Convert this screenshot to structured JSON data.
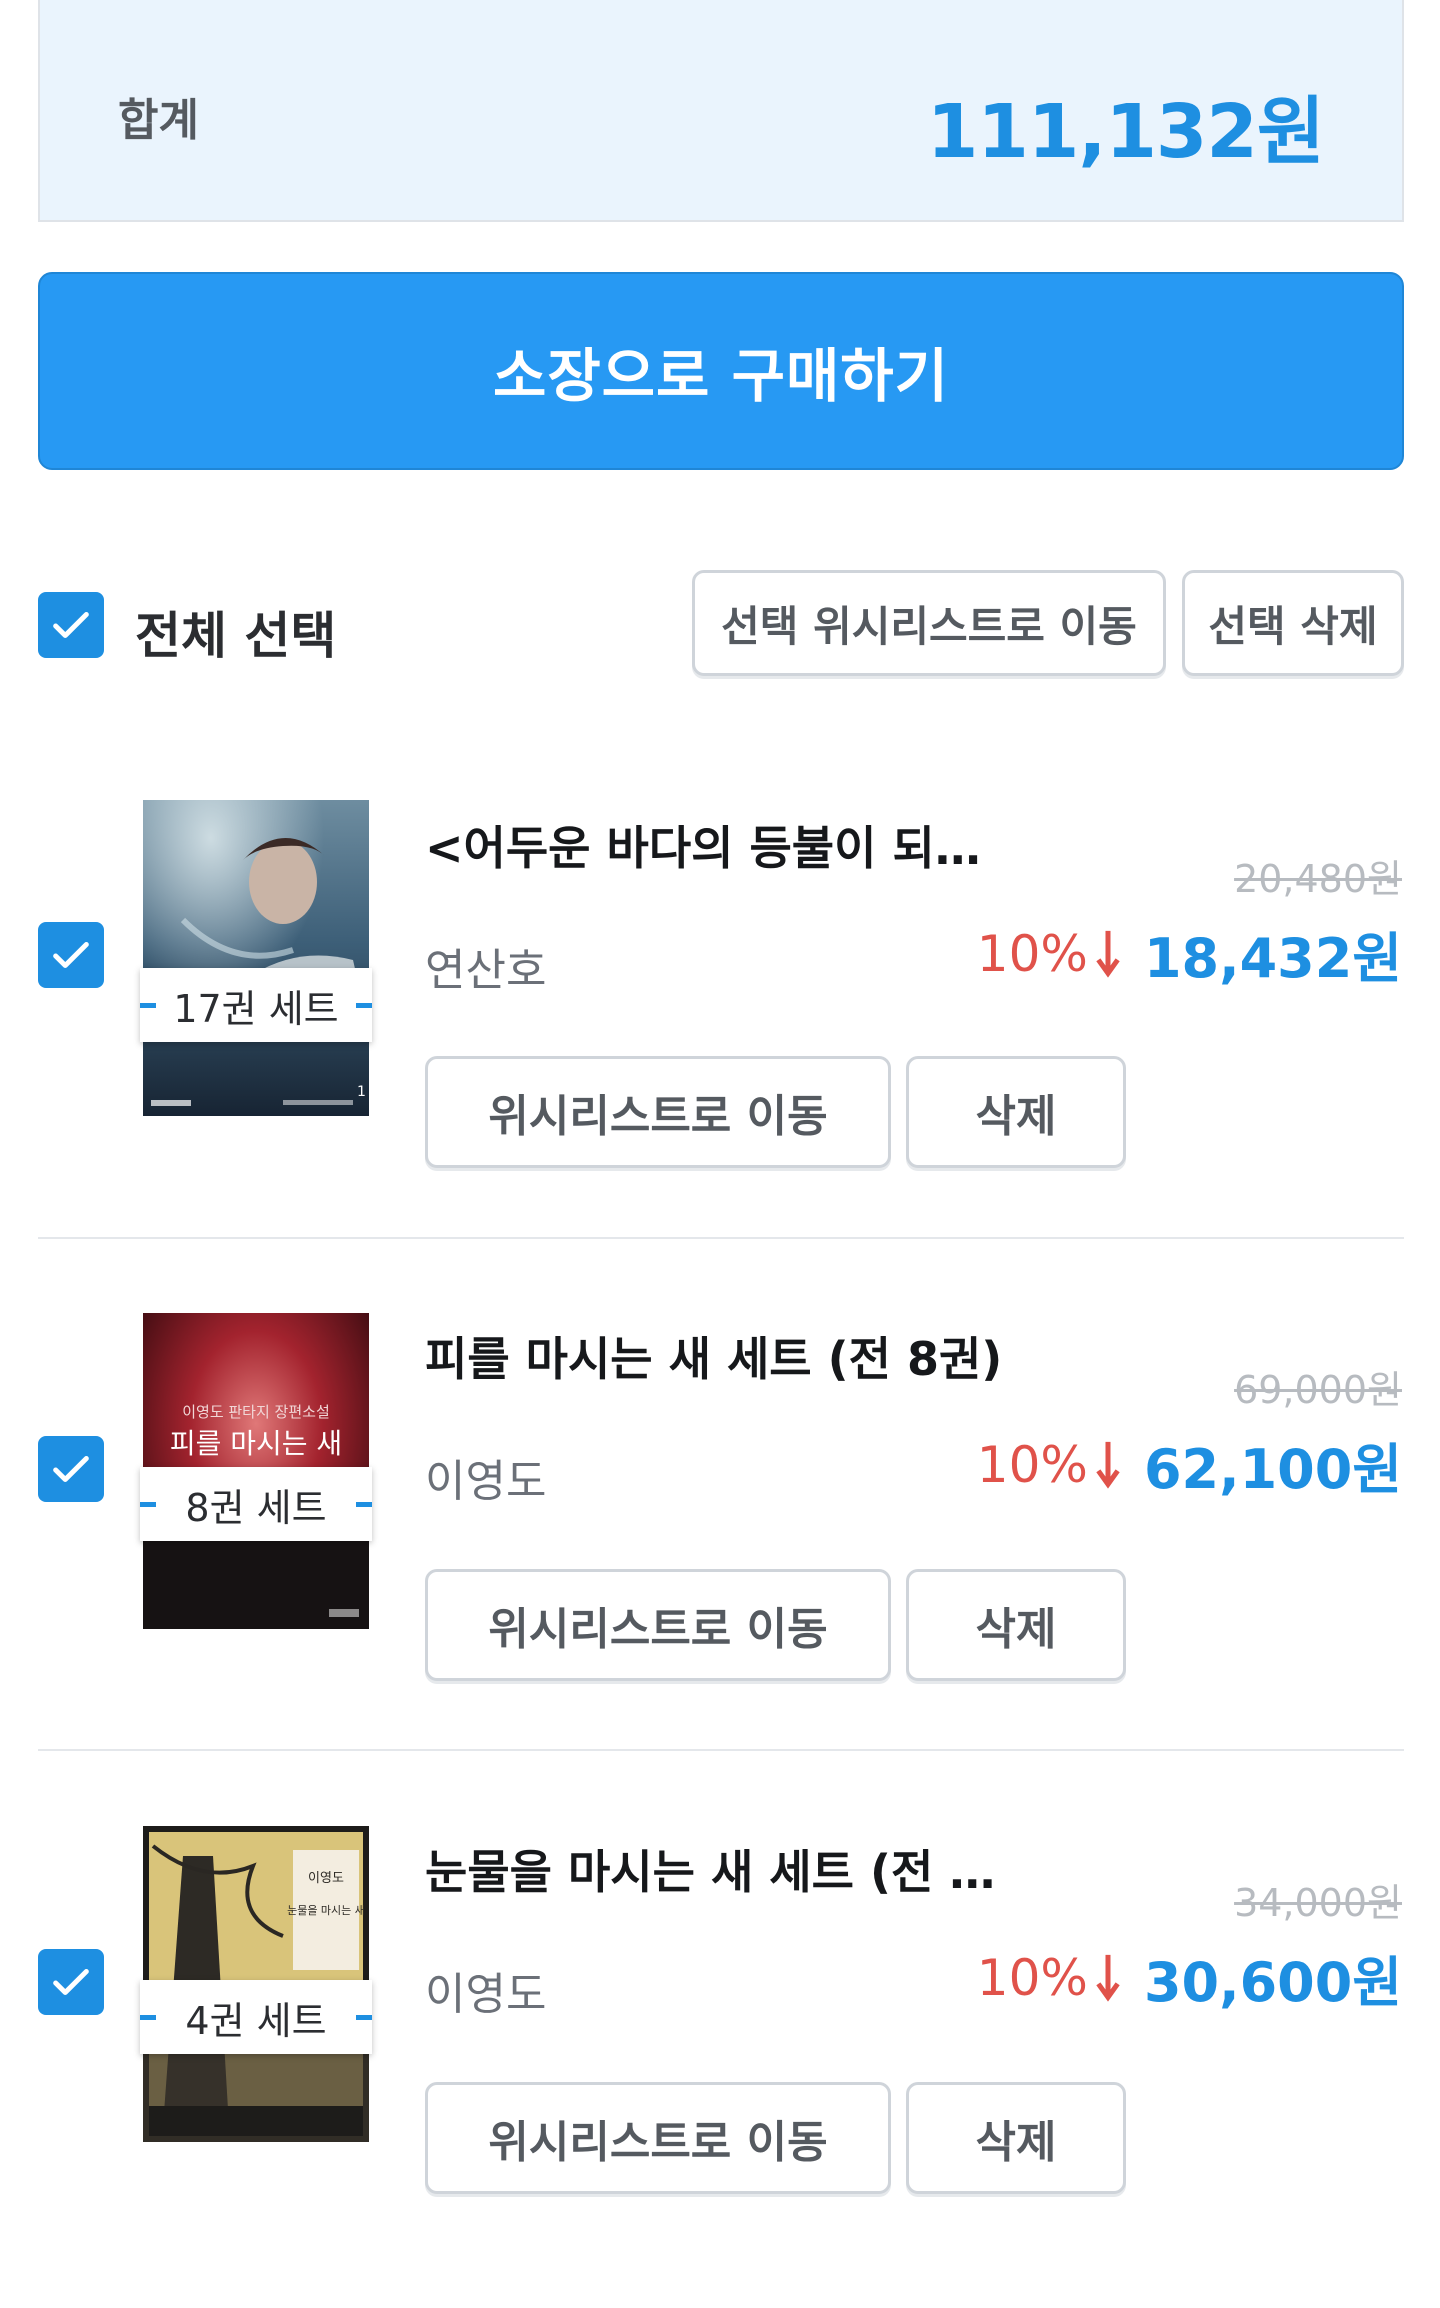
{
  "summary": {
    "total_label": "합계",
    "total_value": "111,132원"
  },
  "buy_button": "소장으로 구매하기",
  "select_all": {
    "label": "전체 선택",
    "move_selected": "선택 위시리스트로 이동",
    "delete_selected": "선택 삭제"
  },
  "items": [
    {
      "title": "<어두운 바다의 등불이 되…",
      "author": "연산호",
      "set_label": "17권 세트",
      "original_price": "20,480원",
      "discount": "10%",
      "price": "18,432원",
      "wishlist_label": "위시리스트로 이동",
      "delete_label": "삭제"
    },
    {
      "title": "피를 마시는 새 세트 (전 8권)",
      "author": "이영도",
      "set_label": "8권 세트",
      "original_price": "69,000원",
      "discount": "10%",
      "price": "62,100원",
      "wishlist_label": "위시리스트로 이동",
      "delete_label": "삭제",
      "cover_text": "피를 마시는 새",
      "cover_subtext": "이영도 판타지 장편소설"
    },
    {
      "title": "눈물을 마시는 새 세트 (전 …",
      "author": "이영도",
      "set_label": "4권 세트",
      "original_price": "34,000원",
      "discount": "10%",
      "price": "30,600원",
      "wishlist_label": "위시리스트로 이동",
      "delete_label": "삭제",
      "cover_text": "눈물을 마시는 새",
      "cover_subtext": "이영도"
    }
  ],
  "colors": {
    "accent": "#1e8fe1",
    "discount": "#e0524a",
    "summary_bg": "#eaf4fd"
  },
  "icons": {
    "checkbox": "check-icon",
    "discount": "arrow-down-icon"
  }
}
